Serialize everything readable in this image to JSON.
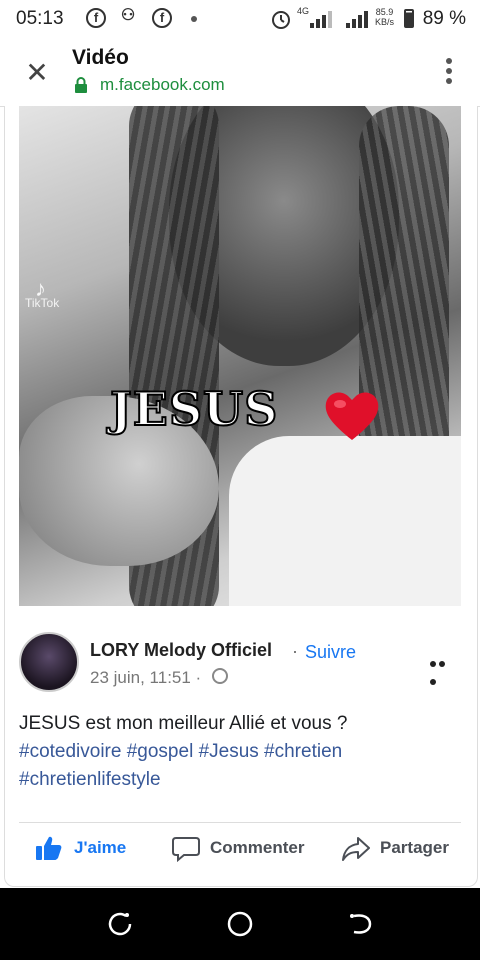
{
  "status_bar": {
    "time": "05:13",
    "network": "4G",
    "speed": "85.9",
    "speed_unit": "KB/s",
    "battery": "89 %"
  },
  "header": {
    "title": "Vidéo",
    "url": "m.facebook.com"
  },
  "video": {
    "overlay_text": "JESUS",
    "watermark": "TikTok"
  },
  "post": {
    "author": "LORY Melody Officiel",
    "separator": "·",
    "follow_label": "Suivre",
    "timestamp": "23 juin, 11:51 ·",
    "text": "JESUS est mon meilleur Allié et vous ?",
    "hashtags": "#cotedivoire #gospel #Jesus #chretien #chretienlifestyle"
  },
  "actions": {
    "like_label": "J'aime",
    "comment_label": "Commenter",
    "share_label": "Partager"
  },
  "colors": {
    "brand_blue": "#1877f2",
    "url_green": "#1e8e3e",
    "hashtag_blue": "#385898",
    "heart_red": "#e0102a"
  }
}
